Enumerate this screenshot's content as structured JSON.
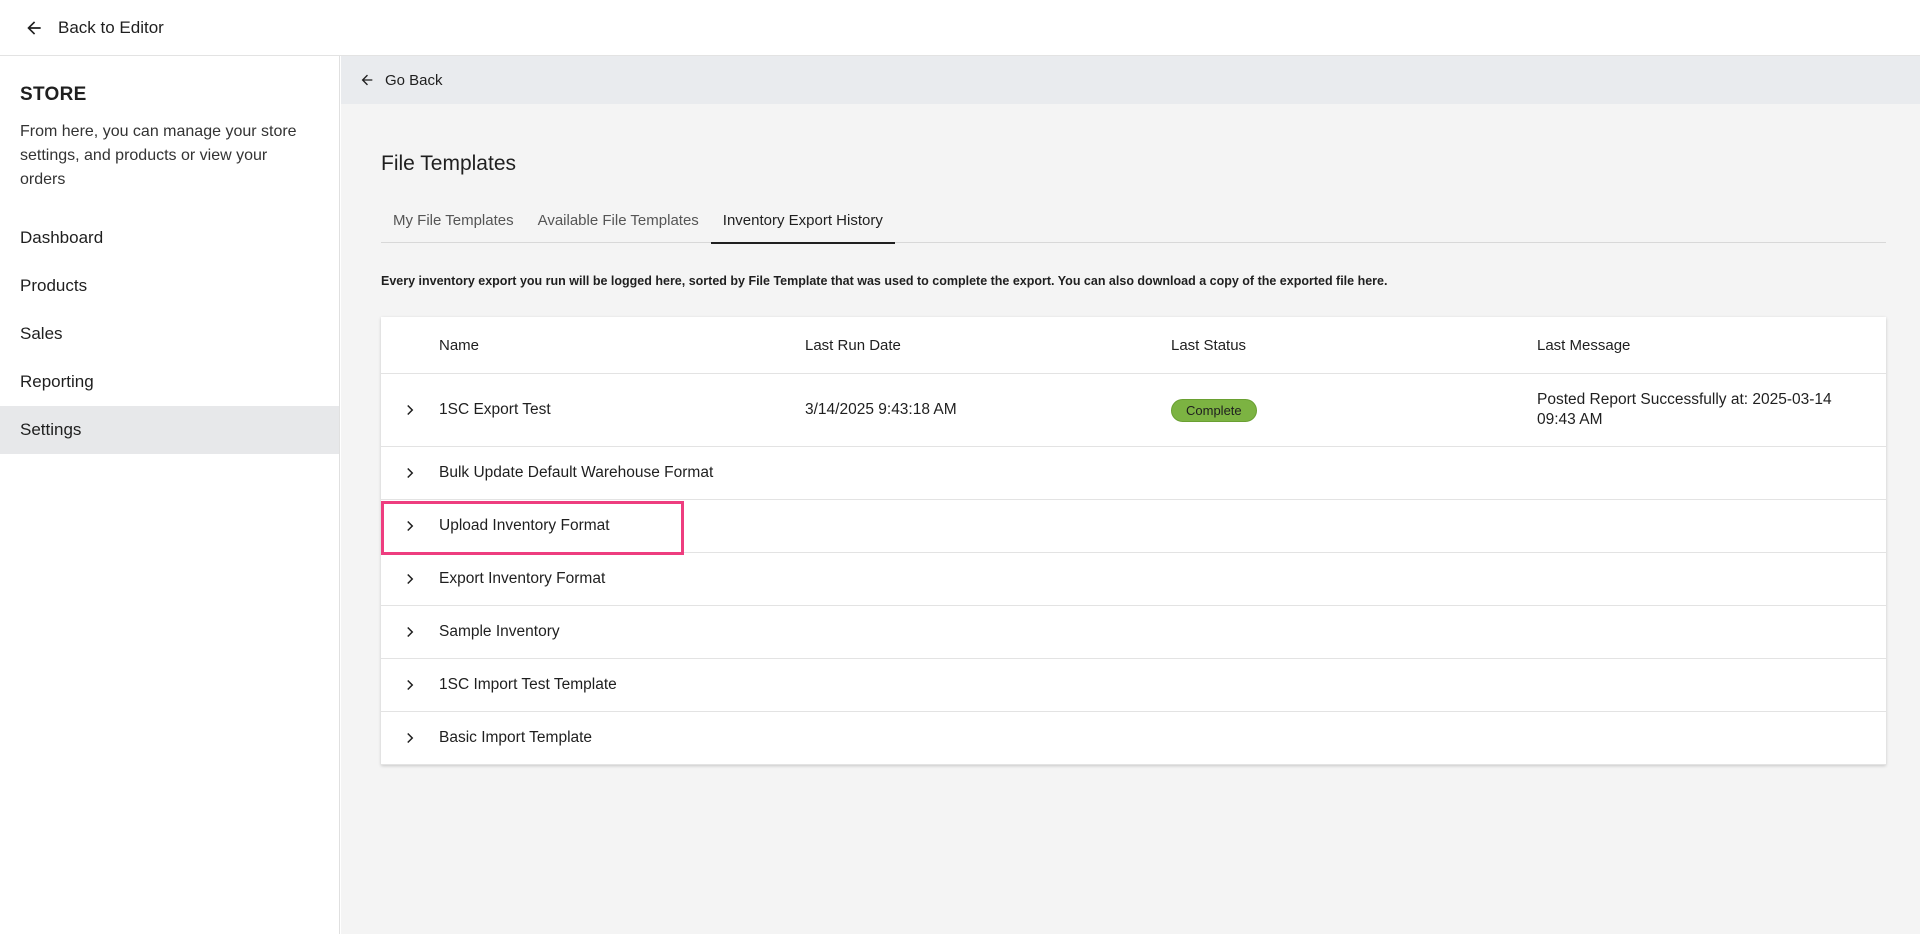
{
  "topbar": {
    "back_label": "Back to Editor"
  },
  "sidebar": {
    "title": "STORE",
    "description": "From here, you can manage your store settings, and products or view your orders",
    "items": [
      {
        "label": "Dashboard"
      },
      {
        "label": "Products"
      },
      {
        "label": "Sales"
      },
      {
        "label": "Reporting"
      },
      {
        "label": "Settings"
      }
    ]
  },
  "main": {
    "go_back_label": "Go Back",
    "title": "File Templates",
    "tabs": [
      {
        "label": "My File Templates"
      },
      {
        "label": "Available File Templates"
      },
      {
        "label": "Inventory Export History"
      }
    ],
    "description": "Every inventory export you run will be logged here, sorted by File Template that was used to complete the export. You can also download a copy of the exported file here.",
    "table": {
      "headers": {
        "name": "Name",
        "last_run": "Last Run Date",
        "status": "Last Status",
        "message": "Last Message"
      },
      "rows": [
        {
          "name": "1SC Export Test",
          "last_run": "3/14/2025 9:43:18 AM",
          "status": "Complete",
          "message": "Posted Report Successfully at: 2025-03-14 09:43 AM"
        },
        {
          "name": "Bulk Update Default Warehouse Format"
        },
        {
          "name": "Upload Inventory Format"
        },
        {
          "name": "Export Inventory Format"
        },
        {
          "name": "Sample Inventory"
        },
        {
          "name": "1SC Import Test Template"
        },
        {
          "name": "Basic Import Template"
        }
      ]
    }
  },
  "colors": {
    "status_complete": "#7cb342",
    "highlight": "#ee3d7f",
    "active_nav": "#e7e8ea"
  }
}
